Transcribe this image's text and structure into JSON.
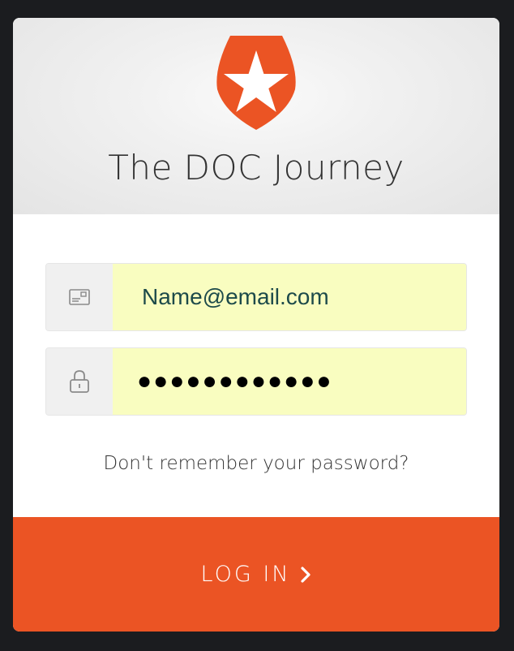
{
  "app": {
    "title": "The DOC Journey"
  },
  "form": {
    "email": {
      "value": "Name@email.com",
      "icon": "envelope-icon"
    },
    "password": {
      "value": "●●●●●●●●●●●●",
      "icon": "lock-icon"
    },
    "forgot_password_label": "Don't remember your password?",
    "login_label": "LOG IN",
    "login_icon": "chevron-right-icon"
  },
  "colors": {
    "brand": "#eb5424",
    "autofill_background": "#f9fdc0",
    "page_background": "#1b1c1f"
  }
}
